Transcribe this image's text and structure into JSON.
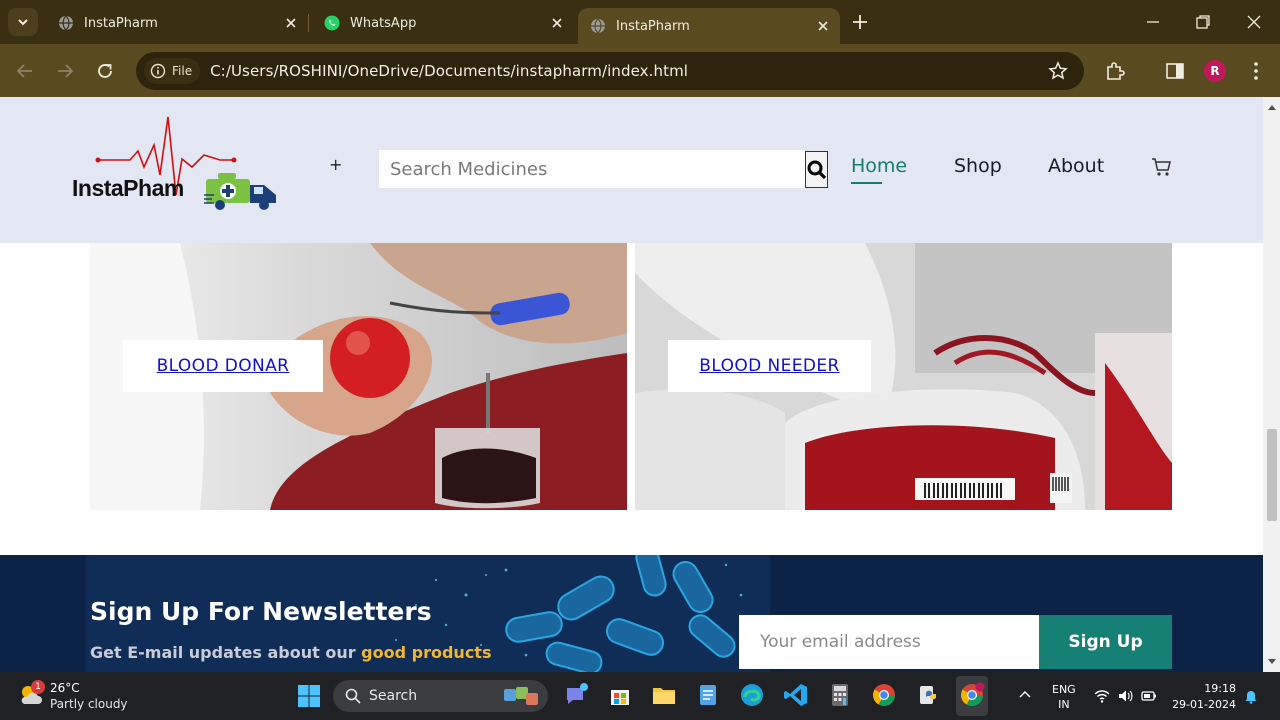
{
  "browser": {
    "tabs": [
      {
        "title": "InstaPharm",
        "icon": "globe-icon",
        "active": false
      },
      {
        "title": "WhatsApp",
        "icon": "whatsapp-icon",
        "active": false
      },
      {
        "title": "InstaPharm",
        "icon": "globe-icon",
        "active": true
      }
    ],
    "chip_label": "File",
    "url": "C:/Users/ROSHINI/OneDrive/Documents/instapharm/index.html",
    "profile_initial": "R"
  },
  "site": {
    "logo_text": "InstaPham",
    "plus_mark": "+",
    "search": {
      "placeholder": "Search Medicines"
    },
    "nav": {
      "home": "Home",
      "shop": "Shop",
      "about": "About"
    },
    "cards": {
      "donor_label": "BLOOD DONAR",
      "needer_label": "BLOOD NEEDER"
    },
    "newsletter": {
      "title": "Sign Up For Newsletters",
      "subtitle_prefix": "Get E-mail updates about our ",
      "subtitle_highlight": "good products",
      "email_placeholder": "Your email address",
      "button_label": "Sign Up"
    }
  },
  "taskbar": {
    "weather": {
      "temp": "26°C",
      "condition": "Partly cloudy",
      "badge": "1"
    },
    "search_label": "Search",
    "lang_line1": "ENG",
    "lang_line2": "IN",
    "time": "19:18",
    "date": "29-01-2024"
  },
  "colors": {
    "chrome_dark": "#3a2f13",
    "chrome_toolbar": "#5a4a20",
    "header_bg": "#e3e7f3",
    "accent_teal": "#157d6f",
    "newsletter_bg": "#0c2246",
    "highlight_yellow": "#f2b632"
  }
}
